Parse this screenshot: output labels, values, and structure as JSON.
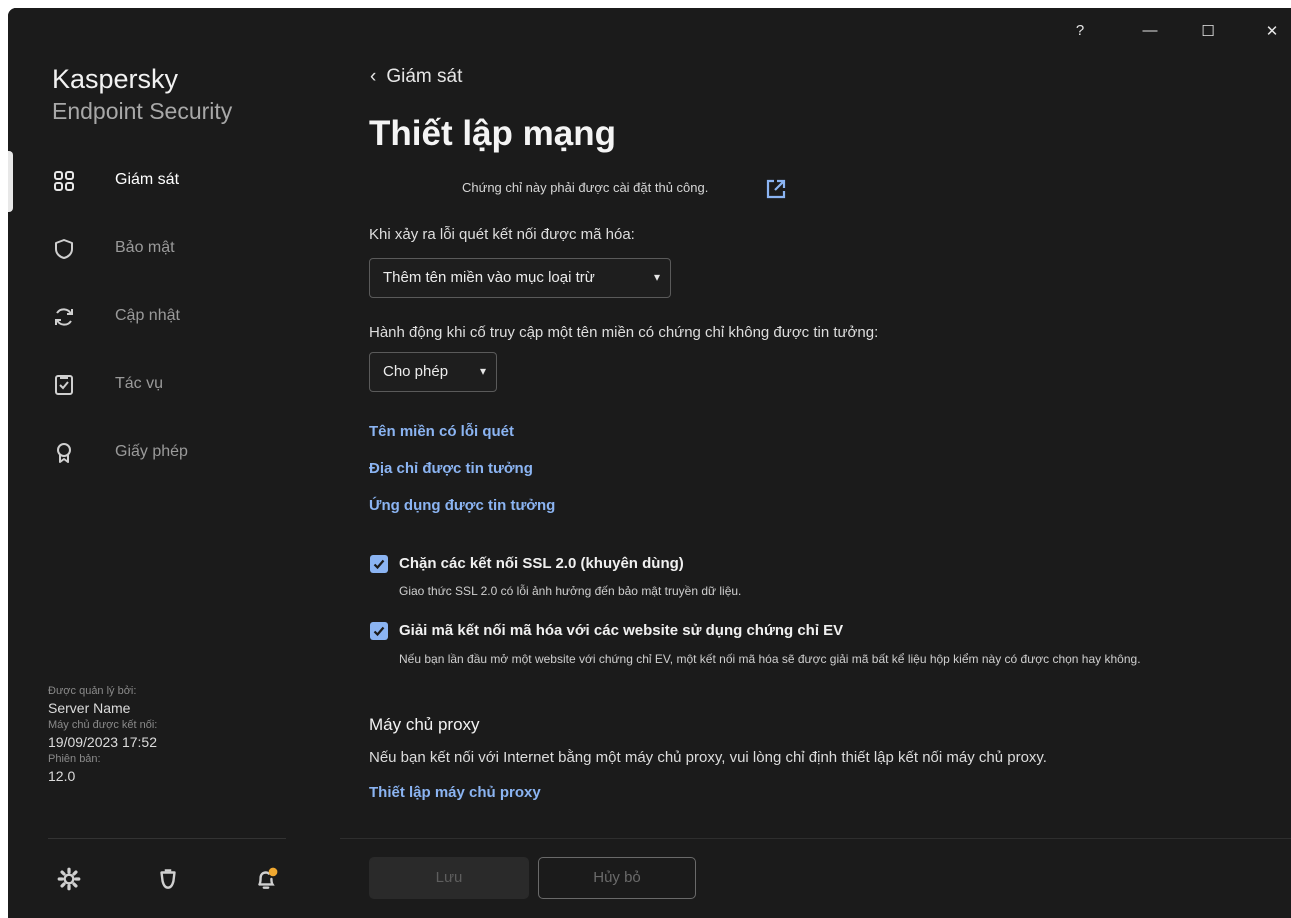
{
  "window": {
    "help_label": "?",
    "minimize_label": "—",
    "maximize_label": "☐",
    "close_label": "✕"
  },
  "brand": {
    "line1": "Kaspersky",
    "line2": "Endpoint Security"
  },
  "sidebar": {
    "items": [
      {
        "label": "Giám sát",
        "icon": "dashboard-icon",
        "active": true
      },
      {
        "label": "Bảo mật",
        "icon": "shield-icon",
        "active": false
      },
      {
        "label": "Cập nhật",
        "icon": "refresh-icon",
        "active": false
      },
      {
        "label": "Tác vụ",
        "icon": "clipboard-check-icon",
        "active": false
      },
      {
        "label": "Giấy phép",
        "icon": "license-icon",
        "active": false
      }
    ],
    "managed": {
      "managed_by_label": "Được quản lý bởi:",
      "managed_by_value": "Server Name",
      "connected_label": "Máy chủ được kết nối:",
      "connected_value": "19/09/2023 17:52",
      "version_label": "Phiên bản:",
      "version_value": "12.0"
    },
    "bottom_icons": [
      "settings-icon",
      "support-icon",
      "notification-icon"
    ]
  },
  "main": {
    "back_label": "Giám sát",
    "title": "Thiết lập mạng",
    "cert_note": "Chứng chỉ này phải được cài đặt thủ công.",
    "encrypted_error_label": "Khi xảy ra lỗi quét kết nối được mã hóa:",
    "encrypted_error_value": "Thêm tên miền vào mục loại trừ",
    "untrusted_cert_label": "Hành động khi cố truy cập một tên miền có chứng chỉ không được tin tưởng:",
    "untrusted_cert_value": "Cho phép",
    "links": [
      "Tên miền có lỗi quét",
      "Địa chỉ được tin tưởng",
      "Ứng dụng được tin tưởng"
    ],
    "checkboxes": [
      {
        "title": "Chặn các kết nối SSL 2.0 (khuyên dùng)",
        "desc": "Giao thức SSL 2.0 có lỗi ảnh hưởng đến bảo mật truyền dữ liệu.",
        "checked": true
      },
      {
        "title": "Giải mã kết nối mã hóa với các website sử dụng chứng chỉ EV",
        "desc": "Nếu bạn lần đầu mở một website với chứng chỉ EV, một kết nối mã hóa sẽ được giải mã bất kể liệu hộp kiểm này có được chọn hay không.",
        "checked": true
      }
    ],
    "proxy_heading": "Máy chủ proxy",
    "proxy_text": "Nếu bạn kết nối với Internet bằng một máy chủ proxy, vui lòng chỉ định thiết lập kết nối máy chủ proxy.",
    "proxy_link": "Thiết lập máy chủ proxy"
  },
  "footer": {
    "save_label": "Lưu",
    "cancel_label": "Hủy bỏ"
  },
  "colors": {
    "background": "#1b1b1b",
    "link": "#8bb4f2",
    "checkbox": "#8bb4f2",
    "notification_dot": "#f0a830"
  }
}
